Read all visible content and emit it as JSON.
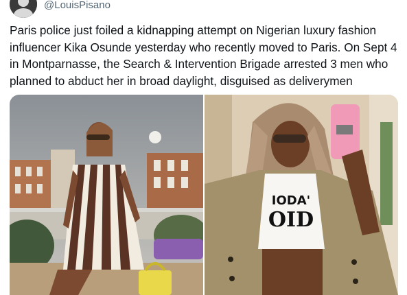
{
  "tweet": {
    "handle": "@LouisPisano",
    "avatar_icon": "user-avatar",
    "text": "Paris police just foiled a kidnapping attempt on Nigerian luxury fashion influencer Kika Osunde yesterday who recently moved to Paris. On Sept 4 in Montparnasse, the Search & Intervention Brigade arrested 3 men who planned to abduct her in broad daylight, disguised as deliverymen"
  },
  "media": {
    "left_photo_icon": "rooftop-photo",
    "right_photo_icon": "mirror-selfie-photo",
    "shirt_print": "IODA' OID"
  },
  "colors": {
    "text_primary": "#0f1419",
    "text_secondary": "#536471"
  }
}
